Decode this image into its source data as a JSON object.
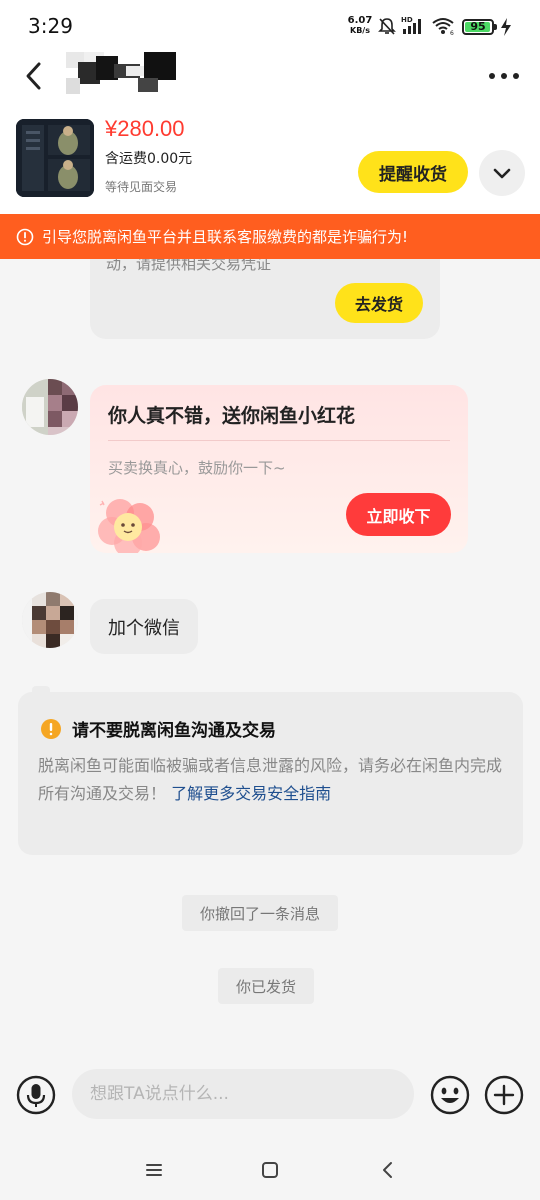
{
  "status_bar": {
    "time": "3:29",
    "net_speed_value": "6.07",
    "net_speed_unit": "KB/s",
    "battery": "95",
    "icons": [
      "mute-icon",
      "signal-icon",
      "wifi-icon",
      "battery-icon",
      "charging-icon"
    ]
  },
  "header": {
    "icons": [
      "back-icon",
      "more-icon"
    ]
  },
  "product": {
    "price": "¥280.00",
    "shipping": "含运费0.00元",
    "trade_mode": "等待见面交易",
    "remind_label": "提醒收货"
  },
  "warning": {
    "text": "引导您脱离闲鱼平台并且联系客服缴费的都是诈骗行为!"
  },
  "messages": {
    "order_card_partial": "动，请提供相关交易凭证",
    "ship_button": "去发货",
    "flower_title": "你人真不错，送你闲鱼小红花",
    "flower_subtitle": "买卖换真心，鼓励你一下~",
    "accept_button": "立即收下",
    "wechat_message": "加个微信",
    "safety_title": "请不要脱离闲鱼沟通及交易",
    "safety_body": "脱离闲鱼可能面临被骗或者信息泄露的风险，请务必在闲鱼内完成所有沟通及交易！",
    "safety_link": "了解更多交易安全指南",
    "system_recall": "你撤回了一条消息",
    "system_shipped": "你已发货"
  },
  "input_bar": {
    "placeholder": "想跟TA说点什么..."
  },
  "colors": {
    "accent_yellow": "#ffe21a",
    "price_red": "#ff3b30",
    "warning_orange": "#ff5e1f",
    "accept_red": "#ff3b3b",
    "link_blue": "#1f4f8f"
  }
}
